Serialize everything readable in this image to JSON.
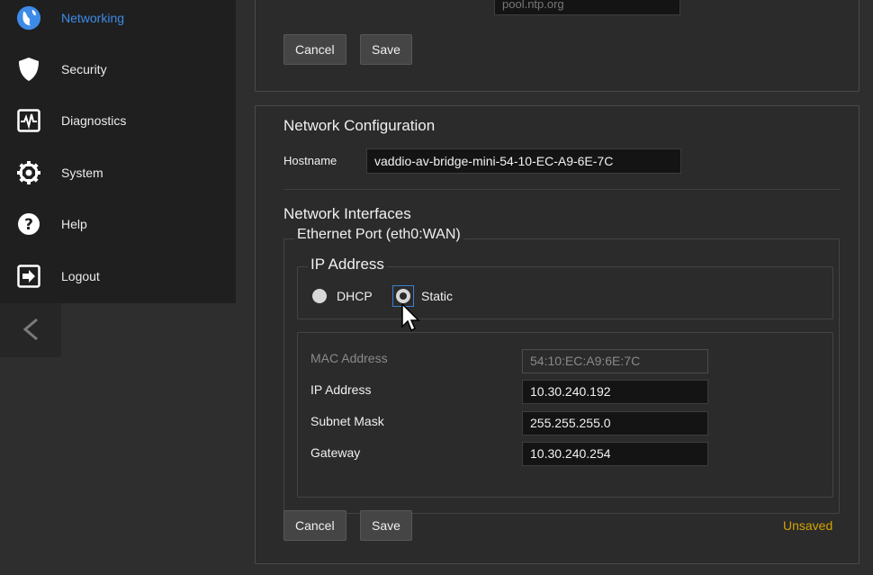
{
  "sidebar": {
    "items": [
      {
        "label": "Networking",
        "icon": "globe-icon",
        "active": true
      },
      {
        "label": "Security",
        "icon": "shield-icon"
      },
      {
        "label": "Diagnostics",
        "icon": "pulse-icon"
      },
      {
        "label": "System",
        "icon": "gear-icon"
      },
      {
        "label": "Help",
        "icon": "question-icon"
      },
      {
        "label": "Logout",
        "icon": "logout-icon"
      }
    ],
    "collapse_icon": "chevron-left-icon"
  },
  "top_panel": {
    "ntp_server_value": "pool.ntp.org",
    "cancel_label": "Cancel",
    "save_label": "Save"
  },
  "network_config": {
    "title": "Network Configuration",
    "hostname_label": "Hostname",
    "hostname_value": "vaddio-av-bridge-mini-54-10-EC-A9-6E-7C",
    "interfaces_title": "Network Interfaces",
    "port_title": "Ethernet Port (eth0:WAN)",
    "ip_mode_title": "IP Address",
    "ip_mode_options": [
      "DHCP",
      "Static"
    ],
    "ip_mode_selected": "Static",
    "fields": {
      "mac_label": "MAC Address",
      "mac_value": "54:10:EC:A9:6E:7C",
      "ip_label": "IP Address",
      "ip_value": "10.30.240.192",
      "subnet_label": "Subnet Mask",
      "subnet_value": "255.255.255.0",
      "gateway_label": "Gateway",
      "gateway_value": "10.30.240.254"
    },
    "cancel_label": "Cancel",
    "save_label": "Save",
    "status_text": "Unsaved"
  },
  "colors": {
    "active_nav": "#3d8be8",
    "unsaved": "#d4a300"
  }
}
